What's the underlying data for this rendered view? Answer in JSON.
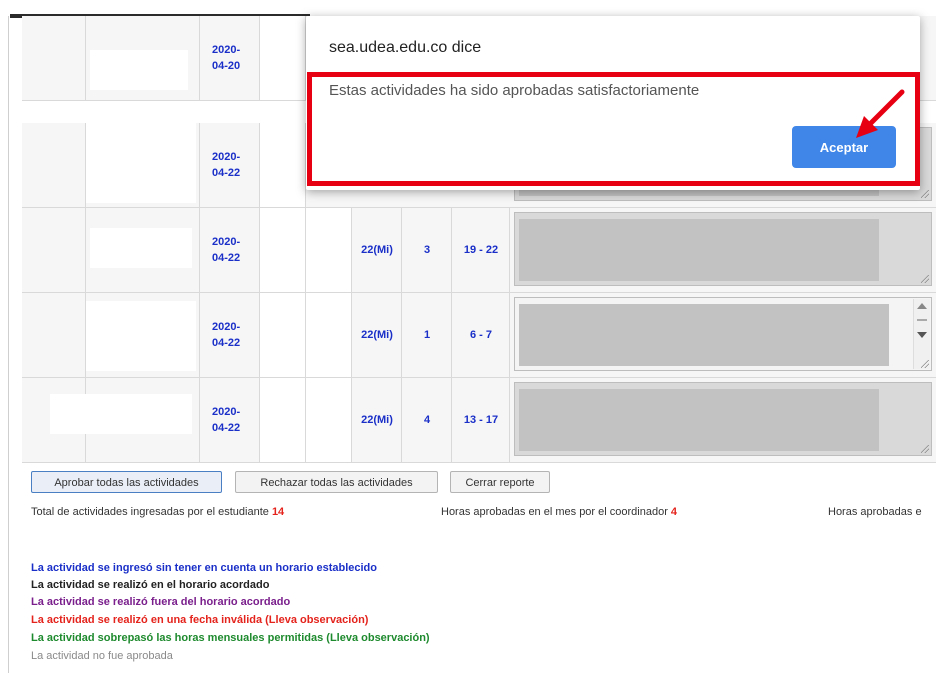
{
  "table": {
    "rows": [
      {
        "date": "2020-\n04-20",
        "day": "",
        "hours": "",
        "range": ""
      },
      {
        "date": "2020-\n04-22",
        "day": "",
        "hours": "",
        "range": ""
      },
      {
        "date": "2020-\n04-22",
        "day": "22(Mi)",
        "hours": "3",
        "range": "19 - 22"
      },
      {
        "date": "2020-\n04-22",
        "day": "22(Mi)",
        "hours": "1",
        "range": "6 - 7"
      },
      {
        "date": "2020-\n04-22",
        "day": "22(Mi)",
        "hours": "4",
        "range": "13 - 17"
      }
    ]
  },
  "actions": {
    "approve_all": "Aprobar todas las actividades",
    "reject_all": "Rechazar todas las actividades",
    "close_report": "Cerrar reporte"
  },
  "stats": {
    "total_label": "Total de actividades ingresadas por el estudiante",
    "total_value": "14",
    "approved_label": "Horas aprobadas en el mes por el coordinador",
    "approved_value": "4",
    "approved_cut_label": "Horas aprobadas e"
  },
  "legend": [
    {
      "text": "La actividad se ingresó sin tener en cuenta un horario establecido",
      "color": "#1a2fc8"
    },
    {
      "text": "La actividad se realizó en el horario acordado",
      "color": "#222222"
    },
    {
      "text": "La actividad se realizó fuera del horario acordado",
      "color": "#7a1f8c"
    },
    {
      "text": "La actividad se realizó en una fecha inválida (Lleva observación)",
      "color": "#e4231c"
    },
    {
      "text": "La actividad sobrepasó las horas mensuales permitidas (Lleva observación)",
      "color": "#1e8a2e"
    },
    {
      "text": "La actividad no fue aprobada",
      "color": "#8a8a8a"
    }
  ],
  "dialog": {
    "title": "sea.udea.edu.co dice",
    "message": "Estas actividades ha sido aprobadas satisfactoriamente",
    "ok_label": "Aceptar"
  },
  "colors": {
    "accent": "#3f86e8",
    "highlight": "#e60012",
    "link": "#1a2fc8"
  }
}
